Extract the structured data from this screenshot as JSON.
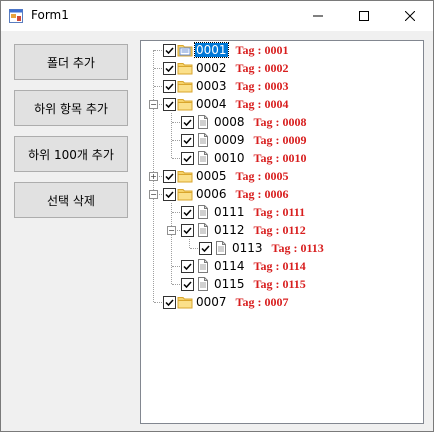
{
  "window": {
    "title": "Form1"
  },
  "buttons": {
    "add_folder": "폴더 추가",
    "add_child": "하위 항목 추가",
    "add_100": "하위 100개 추가",
    "delete_selected": "선택 삭제"
  },
  "tree": {
    "nodes": [
      {
        "text": "0001",
        "tag": "Tag : 0001",
        "checked": true,
        "selected": true,
        "type": "folder"
      },
      {
        "text": "0002",
        "tag": "Tag : 0002",
        "checked": true,
        "type": "folder"
      },
      {
        "text": "0003",
        "tag": "Tag : 0003",
        "checked": true,
        "type": "folder"
      },
      {
        "text": "0004",
        "tag": "Tag : 0004",
        "checked": true,
        "type": "folder",
        "expanded": true
      },
      {
        "text": "0008",
        "tag": "Tag : 0008",
        "checked": true,
        "type": "file"
      },
      {
        "text": "0009",
        "tag": "Tag : 0009",
        "checked": true,
        "type": "file"
      },
      {
        "text": "0010",
        "tag": "Tag : 0010",
        "checked": true,
        "type": "file"
      },
      {
        "text": "0005",
        "tag": "Tag : 0005",
        "checked": true,
        "type": "folder",
        "expanded": false
      },
      {
        "text": "0006",
        "tag": "Tag : 0006",
        "checked": true,
        "type": "folder",
        "expanded": true
      },
      {
        "text": "0111",
        "tag": "Tag : 0111",
        "checked": true,
        "type": "file"
      },
      {
        "text": "0112",
        "tag": "Tag : 0112",
        "checked": true,
        "type": "file",
        "expanded": true
      },
      {
        "text": "0113",
        "tag": "Tag : 0113",
        "checked": true,
        "type": "file"
      },
      {
        "text": "0114",
        "tag": "Tag : 0114",
        "checked": true,
        "type": "file"
      },
      {
        "text": "0115",
        "tag": "Tag : 0115",
        "checked": true,
        "type": "file"
      },
      {
        "text": "0007",
        "tag": "Tag : 0007",
        "checked": true,
        "type": "folder"
      }
    ]
  },
  "colors": {
    "tag": "#d81e1e",
    "selection": "#0078d7"
  }
}
